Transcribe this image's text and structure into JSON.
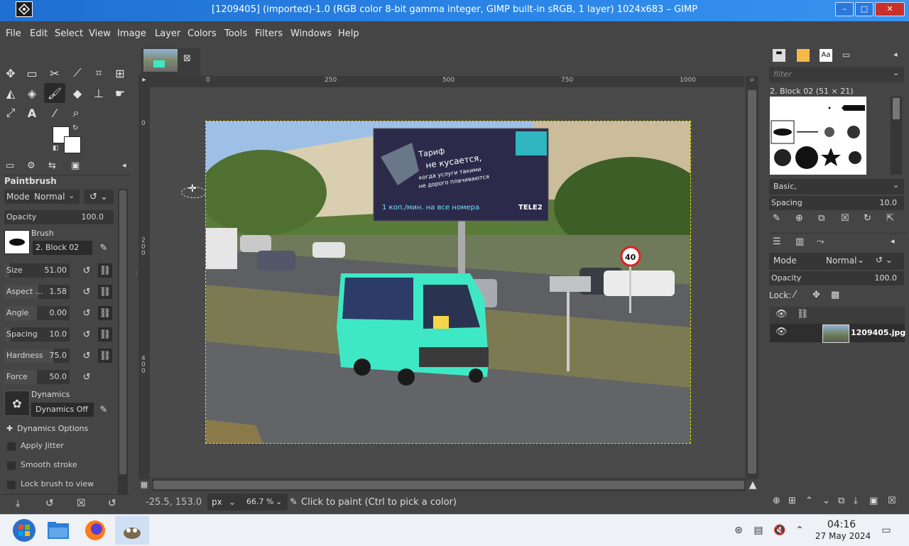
{
  "window": {
    "title": "[1209405] (imported)-1.0 (RGB color 8-bit gamma integer, GIMP built-in sRGB, 1 layer) 1024x683 – GIMP",
    "minimize": "–",
    "maximize": "□",
    "close": "✕"
  },
  "menu": [
    "File",
    "Edit",
    "Select",
    "View",
    "Image",
    "Layer",
    "Colors",
    "Tools",
    "Filters",
    "Windows",
    "Help"
  ],
  "tool_options": {
    "title": "Paintbrush",
    "mode_label": "Mode",
    "mode_value": "Normal",
    "opacity_label": "Opacity",
    "opacity_value": "100.0",
    "brush_label": "Brush",
    "brush_value": "2. Block 02",
    "rows": [
      {
        "label": "Size",
        "value": "51.00",
        "fill": 0.08
      },
      {
        "label": "Aspect ...",
        "value": "1.58",
        "fill": 0.52
      },
      {
        "label": "Angle",
        "value": "0.00",
        "fill": 0.5
      },
      {
        "label": "Spacing",
        "value": "10.0",
        "fill": 0.1
      },
      {
        "label": "Hardness",
        "value": "75.0",
        "fill": 0.75
      },
      {
        "label": "Force",
        "value": "50.0",
        "fill": 0.5
      }
    ],
    "dynamics_label": "Dynamics",
    "dynamics_value": "Dynamics Off",
    "dynamics_options": "Dynamics Options",
    "apply_jitter": "Apply Jitter",
    "smooth_stroke": "Smooth stroke",
    "lock_brush": "Lock brush to view"
  },
  "rulers": {
    "h": [
      "0",
      "250",
      "500",
      "750",
      "1000"
    ],
    "v": [
      "0",
      "2\n0\n0",
      "4\n0\n0"
    ]
  },
  "status": {
    "coords": "-25.5, 153.0",
    "unit": "px",
    "zoom": "66.7 %",
    "message": "Click to paint (Ctrl to pick a color)"
  },
  "brushes": {
    "filter_placeholder": "filter",
    "current": "2. Block 02 (51 × 21)",
    "preset": "Basic,",
    "spacing_label": "Spacing",
    "spacing_value": "10.0",
    "tab_text": "Aa"
  },
  "layers": {
    "mode_label": "Mode",
    "mode_value": "Normal",
    "opacity_label": "Opacity",
    "opacity_value": "100.0",
    "lock_label": "Lock:",
    "layer_name": "1209405.jpg"
  },
  "photo": {
    "billboard_line1": "Тариф",
    "billboard_line2": "не кусается,",
    "billboard_line3": "когда услуги такими",
    "billboard_line4": "не дорого плачиваются",
    "billboard_bottom": "1 коп./мин. на все номера",
    "billboard_brand": "TELE2",
    "sign": "40"
  },
  "taskbar": {
    "time": "04:16",
    "date": "27 May 2024"
  },
  "colors": {
    "titlebar": "#2b86e8",
    "panel": "#454545",
    "canvas_bg": "#4a4a4a",
    "minibus": "#3ee8c4"
  }
}
